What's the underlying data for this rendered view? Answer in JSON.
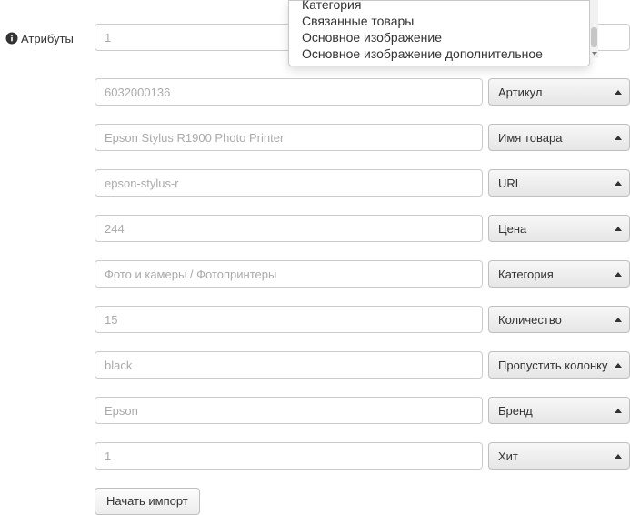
{
  "sidebar": {
    "attributes_label": "Атрибуты"
  },
  "dropdown_menu": {
    "items": [
      "Категория",
      "Связанные товары",
      "Основное изображение",
      "Основное изображение дополнительное"
    ]
  },
  "rows": [
    {
      "value": "1",
      "selector": null
    },
    {
      "value": "6032000136",
      "selector": "Артикул"
    },
    {
      "value": "Epson Stylus R1900 Photo Printer",
      "selector": "Имя товара"
    },
    {
      "value": "epson-stylus-r",
      "selector": "URL"
    },
    {
      "value": "244",
      "selector": "Цена"
    },
    {
      "value": "Фото и камеры / Фотопринтеры",
      "selector": "Категория"
    },
    {
      "value": "15",
      "selector": "Количество"
    },
    {
      "value": "black",
      "selector": "Пропустить колонку"
    },
    {
      "value": "Epson",
      "selector": "Бренд"
    },
    {
      "value": "1",
      "selector": "Хит"
    }
  ],
  "buttons": {
    "start_import": "Начать импорт"
  }
}
